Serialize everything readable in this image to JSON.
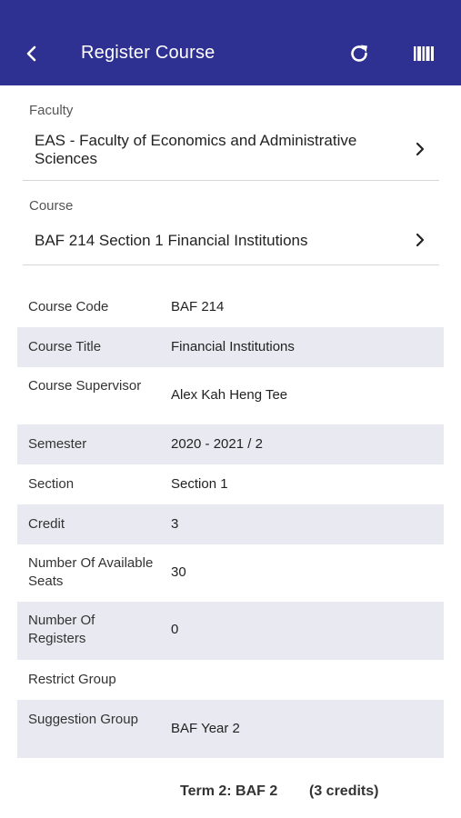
{
  "header": {
    "title": "Register Course",
    "back_icon": "chevron-left-icon",
    "refresh_icon": "refresh-icon",
    "barcode_icon": "barcode-icon",
    "color": "#2f3192"
  },
  "faculty": {
    "label": "Faculty",
    "value": "EAS - Faculty of Economics and Administrative Sciences"
  },
  "course": {
    "label": "Course",
    "value": "BAF 214 Section 1 Financial Institutions"
  },
  "details": [
    {
      "key": "Course Code",
      "value": "BAF 214"
    },
    {
      "key": "Course Title",
      "value": "Financial Institutions"
    },
    {
      "key": "Course Supervisor",
      "value": "Alex Kah Heng Tee"
    },
    {
      "key": "Semester",
      "value": "2020 - 2021 / 2"
    },
    {
      "key": "Section",
      "value": "Section 1"
    },
    {
      "key": "Credit",
      "value": "3"
    },
    {
      "key": "Number Of Available Seats",
      "value": "30"
    },
    {
      "key": "Number Of Registers",
      "value": "0"
    },
    {
      "key": "Restrict Group",
      "value": ""
    },
    {
      "key": "Suggestion Group",
      "value": "BAF Year 2"
    }
  ],
  "footer": {
    "term": "Term 2: BAF 2",
    "credits": "(3 credits)"
  }
}
